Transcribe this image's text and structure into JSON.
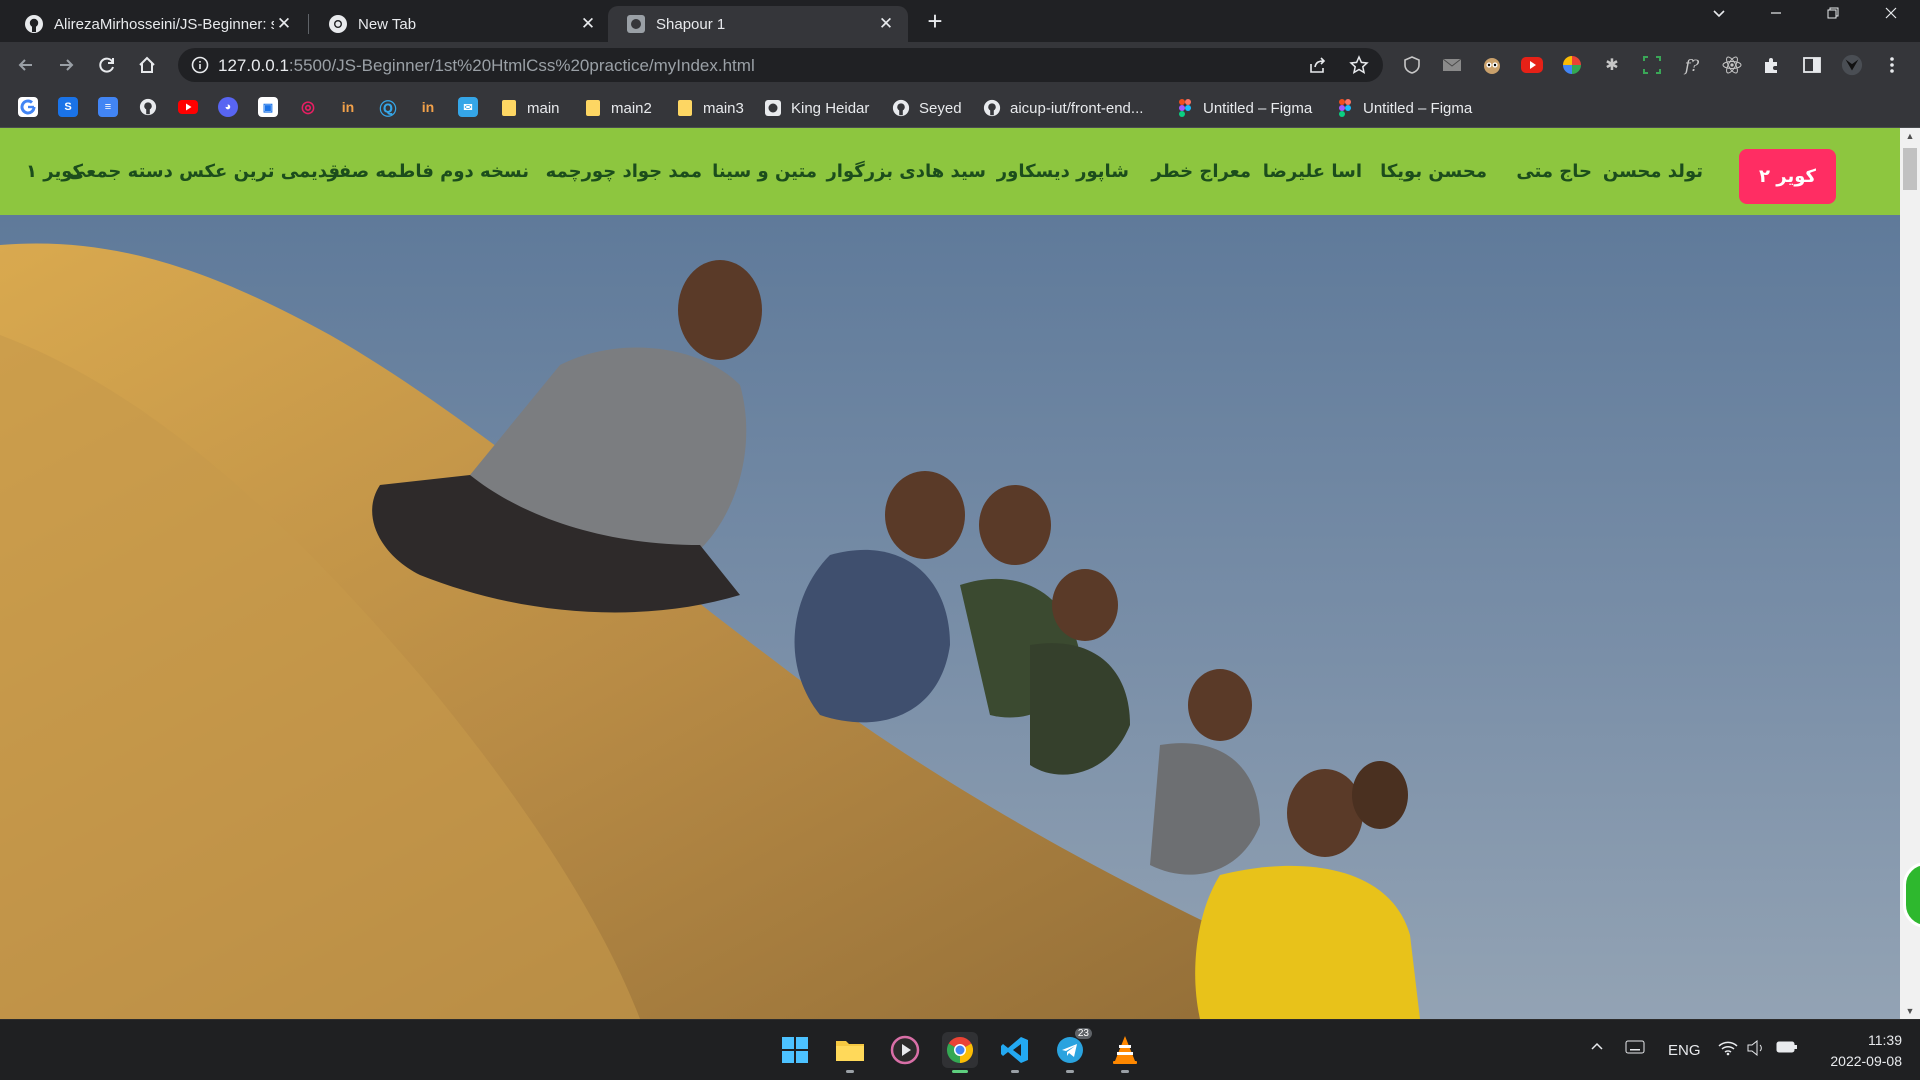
{
  "browser": {
    "tabs": [
      {
        "title": "AlirezaMirhosseini/JS-Beginner: s",
        "favicon": "github-icon"
      },
      {
        "title": "New Tab",
        "favicon": "chrome-icon"
      },
      {
        "title": "Shapour 1",
        "favicon": "page-photo-icon"
      }
    ],
    "active_tab": 2,
    "url_host": "127.0.0.1",
    "url_rest": ":5500/JS-Beginner/1st%20HtmlCss%20practice/myIndex.html",
    "bookmarks": [
      {
        "label": "main",
        "icon": "folder-icon"
      },
      {
        "label": "main2",
        "icon": "folder-icon"
      },
      {
        "label": "main3",
        "icon": "folder-icon"
      },
      {
        "label": "King Heidar",
        "icon": "page-icon"
      },
      {
        "label": "Seyed",
        "icon": "github-icon"
      },
      {
        "label": "aicup-iut/front-end...",
        "icon": "github-icon"
      },
      {
        "label": "Untitled – Figma",
        "icon": "figma-icon"
      },
      {
        "label": "Untitled – Figma",
        "icon": "figma-icon"
      }
    ]
  },
  "site": {
    "nav_active": "کویر ۲",
    "nav": [
      "تولد محسن",
      "حاج متی",
      "محسن بویکا",
      "اسا علیرضا",
      "معراج خطر",
      "شاپور دیسکاور",
      "سید هادی بزرگوار",
      "متین و سینا",
      "ممد جواد چورچمه",
      "نسخه دوم فاطمه صفر",
      "قدیمی ترین عکس دسته جمعی",
      "کویر ۱"
    ],
    "colors": {
      "navbar": "#8dc63f",
      "nav_text": "#1c4d1c",
      "active_button": "#ff2d63"
    }
  },
  "taskbar": {
    "language": "ENG",
    "time": "11:39",
    "date": "2022-09-08",
    "telegram_badge": "23"
  }
}
